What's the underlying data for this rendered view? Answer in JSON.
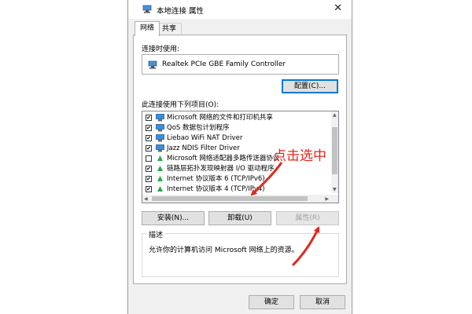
{
  "window": {
    "title": "本地连接 属性",
    "close_glyph": "✕"
  },
  "tabs": [
    {
      "label": "网络",
      "active": true
    },
    {
      "label": "共享",
      "active": false
    }
  ],
  "network": {
    "connect_using_label": "连接时使用:",
    "adapter_name": "Realtek PCIe GBE Family Controller",
    "configure_button": "配置(C)...",
    "items_label": "此连接使用下列项目(O):",
    "items": [
      {
        "checked": true,
        "icon": "network-client-icon",
        "label": "Microsoft 网络的文件和打印机共享"
      },
      {
        "checked": true,
        "icon": "network-service-icon",
        "label": "QoS 数据包计划程序"
      },
      {
        "checked": true,
        "icon": "network-service-icon",
        "label": "Liebao WiFi NAT Driver"
      },
      {
        "checked": true,
        "icon": "network-service-icon",
        "label": "Jazz NDIS Filter Driver"
      },
      {
        "checked": false,
        "icon": "protocol-icon",
        "label": "Microsoft 网络适配器多路传送器协议"
      },
      {
        "checked": true,
        "icon": "protocol-icon",
        "label": "链路层拓扑发现映射器 I/O 驱动程序"
      },
      {
        "checked": true,
        "icon": "protocol-icon",
        "label": "Internet 协议版本 6 (TCP/IPv6)"
      },
      {
        "checked": true,
        "icon": "protocol-icon",
        "label": "Internet 协议版本 4 (TCP/IPv4)"
      }
    ],
    "install_button": "安装(N)...",
    "uninstall_button": "卸载(U)",
    "properties_button": "属性(R)",
    "description_legend": "描述",
    "description_text": "允许你的计算机访问 Microsoft 网络上的资源。"
  },
  "footer": {
    "ok_button": "确定",
    "cancel_button": "取消"
  },
  "annotation": {
    "text": "点击选中",
    "color": "#e0281c"
  }
}
